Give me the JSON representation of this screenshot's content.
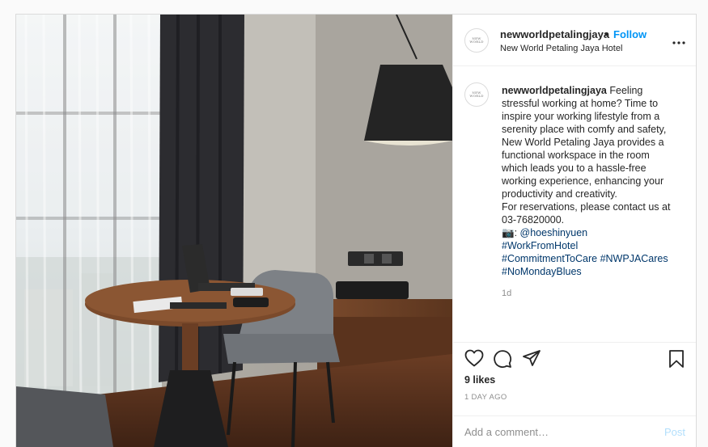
{
  "post": {
    "username": "newworldpetalingjaya",
    "dot": "•",
    "follow_label": "Follow",
    "location": "New World Petaling Jaya Hotel",
    "avatar_text": "NEW WORLD"
  },
  "caption": {
    "username": "newworldpetalingjaya",
    "text_lines": [
      "Feeling",
      "stressful working at home? Time to",
      "inspire your working lifestyle from a",
      "serenity place with comfy and safety,",
      "New World Petaling Jaya provides a",
      "functional workspace in the room",
      "which leads you to a hassle-free",
      "working experience, enhancing your",
      "productivity and creativity.",
      "For reservations, please contact us at",
      "03-76820000."
    ],
    "camera_emoji": "📷",
    "credit_prefix": ": ",
    "credit_handle": "@hoeshinyuen",
    "hashtags_line1": "#WorkFromHotel",
    "hashtags_line2a": "#CommitmentToCare",
    "hashtags_line2b": "#NWPJACares",
    "hashtags_line3": "#NoMondayBlues",
    "time": "1d"
  },
  "actions": {
    "like_icon": "heart-icon",
    "comment_icon": "comment-icon",
    "share_icon": "share-icon",
    "save_icon": "bookmark-icon"
  },
  "likes": "9 likes",
  "posted_ago": "1 DAY AGO",
  "comment_box": {
    "placeholder": "Add a comment…",
    "post_label": "Post"
  },
  "colors": {
    "link_blue": "#0095f6",
    "hashtag": "#00376b",
    "muted": "#8e8e8e",
    "border": "#dbdbdb",
    "post_disabled": "#b2dffc"
  }
}
